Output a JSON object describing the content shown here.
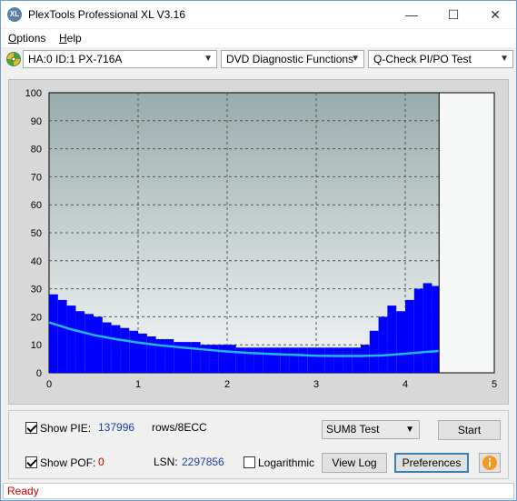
{
  "window": {
    "title": "PlexTools Professional XL V3.16",
    "minimize": "—",
    "maximize": "☐",
    "close": "✕"
  },
  "menu": [
    {
      "label": "Options",
      "underline": "O",
      "rest": "ptions"
    },
    {
      "label": "Help",
      "underline": "H",
      "rest": "elp"
    }
  ],
  "toolbar": {
    "drive": "HA:0 ID:1  PX-716A",
    "function": "DVD Diagnostic Functions",
    "test": "Q-Check PI/PO Test"
  },
  "chart_data": {
    "type": "bar",
    "xlabel": "",
    "ylabel": "",
    "xlim": [
      0,
      5
    ],
    "ylim": [
      0,
      100
    ],
    "x_ticks": [
      "0",
      "1",
      "2",
      "3",
      "4",
      "5"
    ],
    "y_ticks": [
      "0",
      "10",
      "20",
      "30",
      "40",
      "50",
      "60",
      "70",
      "80",
      "90",
      "100"
    ],
    "grid": true,
    "end_marker_x": 4.38,
    "colors": {
      "bars": "#0000ff",
      "curve": "#1fb8f0",
      "plot_top": "#9aacac",
      "plot_bottom": "#f4f6f6"
    },
    "series": [
      {
        "kind": "pie_bars",
        "x": [
          0.0,
          0.1,
          0.2,
          0.3,
          0.4,
          0.5,
          0.6,
          0.7,
          0.8,
          0.9,
          1.0,
          1.1,
          1.2,
          1.3,
          1.4,
          1.5,
          1.6,
          1.7,
          1.8,
          1.9,
          2.0,
          2.1,
          2.2,
          2.3,
          2.4,
          2.5,
          2.6,
          2.7,
          2.8,
          2.9,
          3.0,
          3.1,
          3.2,
          3.3,
          3.4,
          3.5,
          3.6,
          3.7,
          3.8,
          3.9,
          4.0,
          4.1,
          4.2,
          4.3,
          4.38
        ],
        "values": [
          28,
          26,
          24,
          22,
          21,
          20,
          18,
          17,
          16,
          15,
          14,
          13,
          12,
          12,
          11,
          11,
          11,
          10,
          10,
          10,
          10,
          9,
          9,
          9,
          9,
          9,
          9,
          9,
          9,
          9,
          9,
          9,
          9,
          9,
          9,
          10,
          15,
          20,
          24,
          22,
          26,
          30,
          32,
          31,
          28
        ]
      },
      {
        "kind": "curve",
        "x": [
          0.0,
          0.25,
          0.5,
          0.75,
          1.0,
          1.25,
          1.5,
          1.75,
          2.0,
          2.25,
          2.5,
          2.75,
          3.0,
          3.25,
          3.5,
          3.75,
          4.0,
          4.25,
          4.38
        ],
        "values": [
          18,
          15.5,
          13.5,
          12,
          10.8,
          9.8,
          9,
          8.3,
          7.6,
          7.1,
          6.7,
          6.4,
          6.1,
          6.0,
          6.0,
          6.2,
          6.8,
          7.5,
          7.8
        ]
      }
    ]
  },
  "bottom": {
    "show_pie_label": "Show PIE:",
    "show_pie_value": "137996",
    "rows_label": "rows/8ECC",
    "show_pof_label": "Show POF:",
    "show_pof_value": "0",
    "lsn_label": "LSN:",
    "lsn_value": "2297856",
    "logarithmic_label": "Logarithmic",
    "test_select": "SUM8 Test",
    "start_button": "Start",
    "view_log_button": "View Log",
    "preferences_button": "Preferences"
  },
  "status": {
    "text": "Ready"
  }
}
